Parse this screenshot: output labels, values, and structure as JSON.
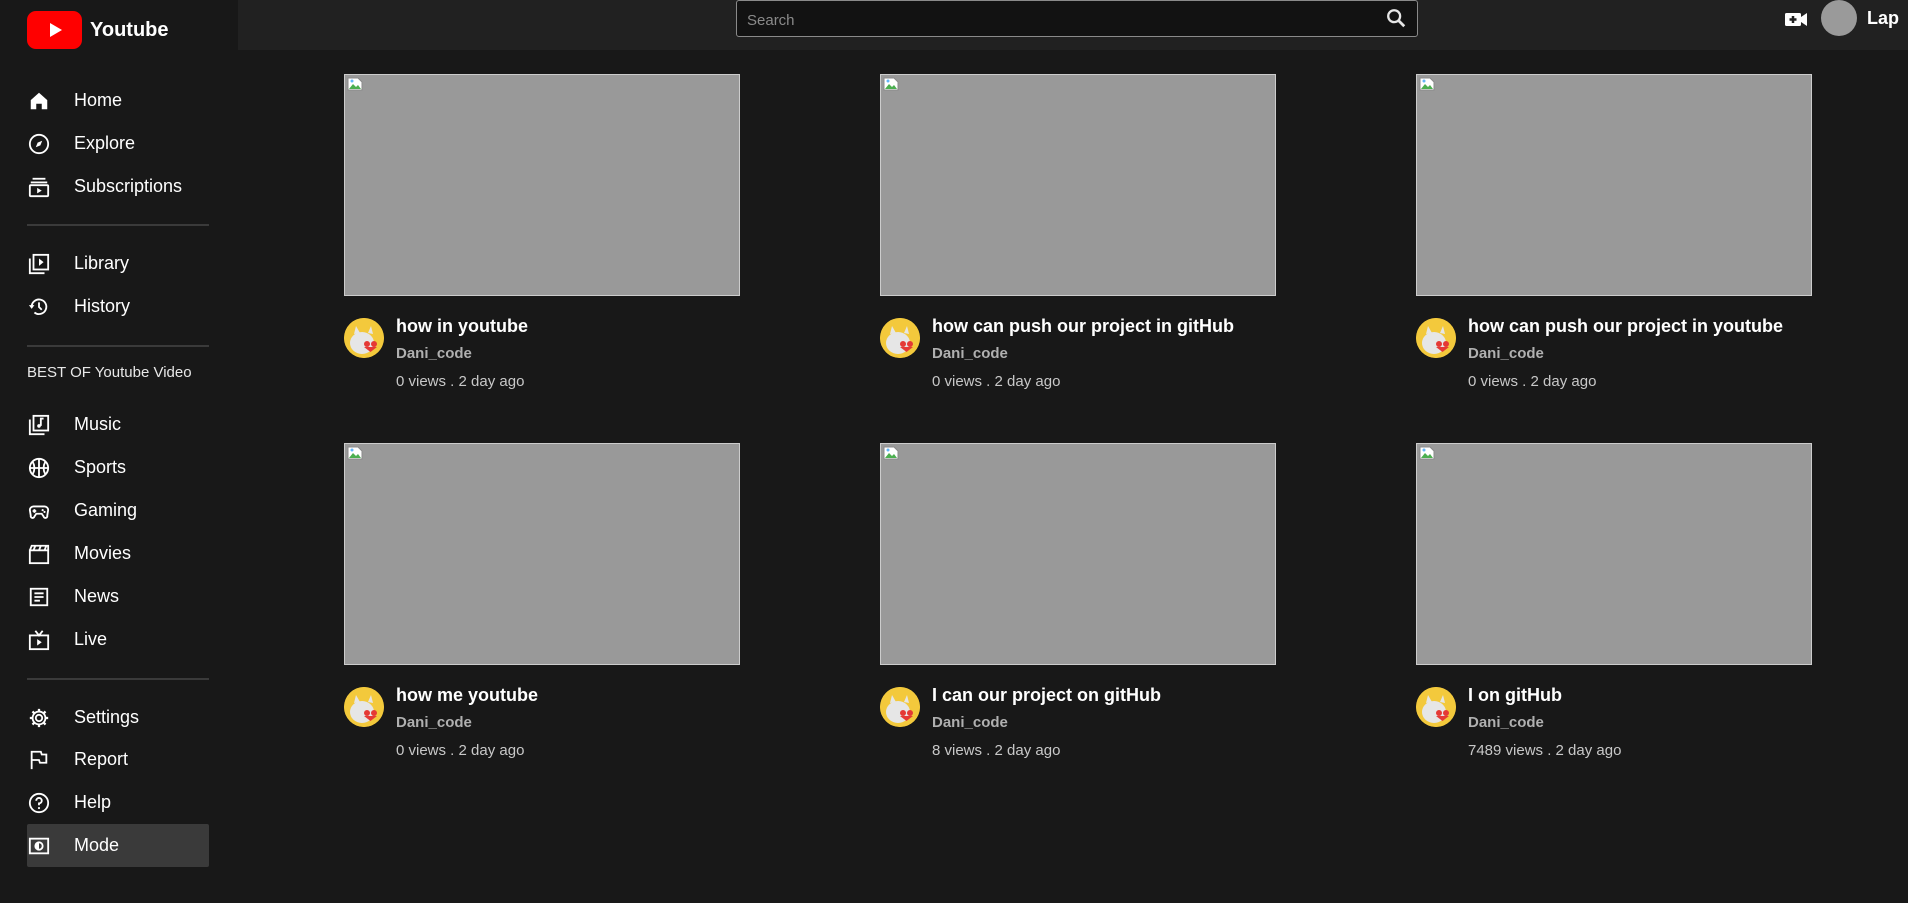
{
  "brand": {
    "name": "Youtube",
    "color": "#ff0000"
  },
  "sidebar": {
    "primary": [
      {
        "label": "Home",
        "icon": "home-icon"
      },
      {
        "label": "Explore",
        "icon": "compass-icon"
      },
      {
        "label": "Subscriptions",
        "icon": "subscriptions-icon"
      }
    ],
    "library": [
      {
        "label": "Library",
        "icon": "library-icon"
      },
      {
        "label": "History",
        "icon": "history-icon"
      }
    ],
    "section_title": "BEST OF Youtube Video",
    "best": [
      {
        "label": "Music",
        "icon": "music-icon"
      },
      {
        "label": "Sports",
        "icon": "sports-icon"
      },
      {
        "label": "Gaming",
        "icon": "gaming-icon"
      },
      {
        "label": "Movies",
        "icon": "movies-icon"
      },
      {
        "label": "News",
        "icon": "news-icon"
      },
      {
        "label": "Live",
        "icon": "live-icon"
      }
    ],
    "bottom": [
      {
        "label": "Settings",
        "icon": "gear-icon"
      },
      {
        "label": "Report",
        "icon": "flag-icon"
      },
      {
        "label": "Help",
        "icon": "help-icon"
      },
      {
        "label": "Mode",
        "icon": "mode-icon",
        "active": true
      }
    ]
  },
  "header": {
    "search_placeholder": "Search",
    "user_name": "Lap"
  },
  "videos": [
    {
      "title": "how in youtube",
      "channel": "Dani_code",
      "stats": "0 views . 2 day ago"
    },
    {
      "title": "how can push our project in gitHub",
      "channel": "Dani_code",
      "stats": "0 views . 2 day ago"
    },
    {
      "title": "how can push our project in youtube",
      "channel": "Dani_code",
      "stats": "0 views . 2 day ago"
    },
    {
      "title": "how me youtube",
      "channel": "Dani_code",
      "stats": "0 views . 2 day ago"
    },
    {
      "title": "I can our project on gitHub",
      "channel": "Dani_code",
      "stats": "8 views . 2 day ago"
    },
    {
      "title": "I on gitHub",
      "channel": "Dani_code",
      "stats": "7489 views . 2 day ago"
    }
  ]
}
